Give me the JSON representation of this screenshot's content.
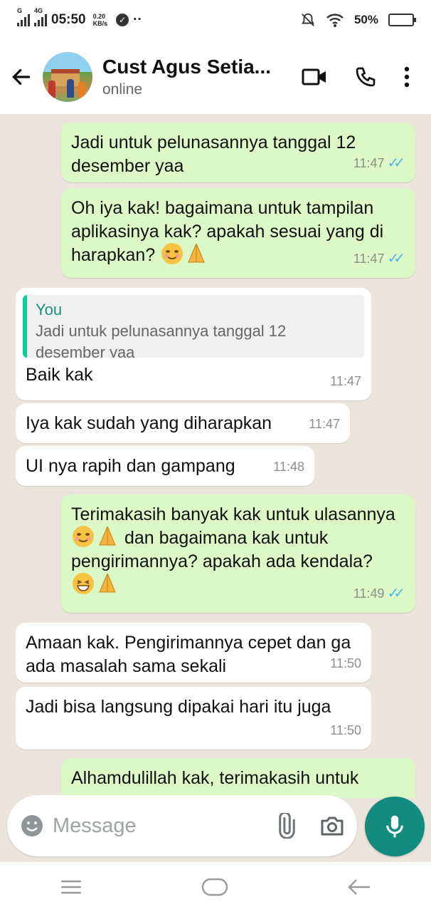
{
  "status_bar": {
    "network_g": "G",
    "network_4g": "4G",
    "time": "05:50",
    "speed_value": "0.20",
    "speed_unit": "KB/s",
    "dots": "··",
    "battery": "50%",
    "battery_level": 0.5
  },
  "header": {
    "contact_name": "Cust Agus Setia...",
    "status": "online"
  },
  "messages": [
    {
      "id": "m1",
      "direction": "out",
      "text": "Jadi untuk pelunasannya tanggal 12 desember yaa",
      "time": "11:47",
      "read": true
    },
    {
      "id": "m2",
      "direction": "out",
      "text": "Oh iya kak! bagaimana untuk tampilan aplikasinya kak? apakah sesuai yang di harapkan?",
      "time": "11:47",
      "read": true
    },
    {
      "id": "m3",
      "direction": "in",
      "quote_author": "You",
      "quote_text": "Jadi untuk pelunasannya tanggal 12 desember yaa",
      "text": "Baik kak",
      "time": "11:47"
    },
    {
      "id": "m4",
      "direction": "in",
      "text": "Iya kak sudah yang diharapkan",
      "time": "11:47"
    },
    {
      "id": "m5",
      "direction": "in",
      "text": "UI nya rapih dan gampang",
      "time": "11:48"
    },
    {
      "id": "m6",
      "direction": "out",
      "text_a": "Terimakasih banyak kak untuk ulasannya",
      "text_b": " dan bagaimana kak untuk pengirimannya? apakah ada kendala?",
      "time": "11:49",
      "read": true
    },
    {
      "id": "m7",
      "direction": "in",
      "text": "Amaan kak. Pengirimannya cepet dan ga ada masalah sama sekali",
      "time": "11:50"
    },
    {
      "id": "m8",
      "direction": "in",
      "text": "Jadi bisa langsung dipakai hari itu juga",
      "time": "11:50"
    },
    {
      "id": "m9",
      "direction": "out",
      "text": "Alhamdulillah kak, terimakasih untuk"
    }
  ],
  "composer": {
    "placeholder": "Message"
  },
  "colors": {
    "outgoing": "#dcf8c6",
    "incoming": "#ffffff",
    "accent": "#128c7e",
    "read_ticks": "#4fb6ec",
    "quote_bar": "#06cf9c"
  },
  "icons": {
    "back": "arrow-left",
    "video": "video-camera",
    "call": "phone",
    "menu": "more-vertical",
    "emoji": "smiley",
    "attach": "paperclip",
    "camera": "camera",
    "mic": "microphone",
    "nav_menu": "three-lines",
    "nav_home": "rounded-rect",
    "nav_back": "arrow-left"
  }
}
